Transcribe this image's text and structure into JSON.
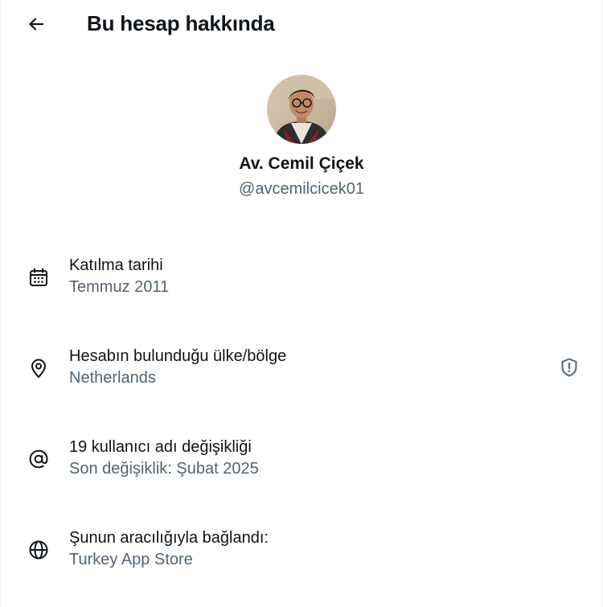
{
  "header": {
    "title": "Bu hesap hakkında",
    "back_icon": "arrow-left-icon"
  },
  "profile": {
    "display_name": "Av. Cemil Çiçek",
    "handle": "@avcemilcicek01"
  },
  "rows": [
    {
      "icon": "calendar-icon",
      "title": "Katılma tarihi",
      "value": "Temmuz 2011"
    },
    {
      "icon": "location-pin-icon",
      "title": "Hesabın bulunduğu ülke/bölge",
      "value": "Netherlands",
      "trailing_icon": "shield-alert-icon"
    },
    {
      "icon": "at-sign-icon",
      "title": "19 kullanıcı adı değişikliği",
      "value": "Son değişiklik: Şubat 2025"
    },
    {
      "icon": "globe-icon",
      "title": "Şunun aracılığıyla bağlandı:",
      "value": "Turkey App Store"
    }
  ],
  "colors": {
    "text": "#0f1419",
    "secondary": "#536471"
  }
}
